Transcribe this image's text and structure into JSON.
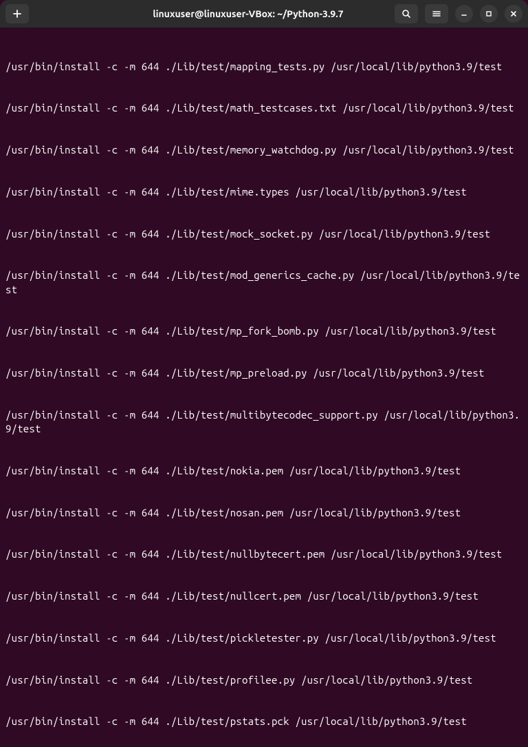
{
  "titlebar": {
    "title": "linuxuser@linuxuser-VBox: ~/Python-3.9.7"
  },
  "terminal": {
    "lines": [
      "/usr/bin/install -c -m 644 ./Lib/test/mapping_tests.py /usr/local/lib/python3.9/test",
      "/usr/bin/install -c -m 644 ./Lib/test/math_testcases.txt /usr/local/lib/python3.9/test",
      "/usr/bin/install -c -m 644 ./Lib/test/memory_watchdog.py /usr/local/lib/python3.9/test",
      "/usr/bin/install -c -m 644 ./Lib/test/mime.types /usr/local/lib/python3.9/test",
      "/usr/bin/install -c -m 644 ./Lib/test/mock_socket.py /usr/local/lib/python3.9/test",
      "/usr/bin/install -c -m 644 ./Lib/test/mod_generics_cache.py /usr/local/lib/python3.9/test",
      "/usr/bin/install -c -m 644 ./Lib/test/mp_fork_bomb.py /usr/local/lib/python3.9/test",
      "/usr/bin/install -c -m 644 ./Lib/test/mp_preload.py /usr/local/lib/python3.9/test",
      "/usr/bin/install -c -m 644 ./Lib/test/multibytecodec_support.py /usr/local/lib/python3.9/test",
      "/usr/bin/install -c -m 644 ./Lib/test/nokia.pem /usr/local/lib/python3.9/test",
      "/usr/bin/install -c -m 644 ./Lib/test/nosan.pem /usr/local/lib/python3.9/test",
      "/usr/bin/install -c -m 644 ./Lib/test/nullbytecert.pem /usr/local/lib/python3.9/test",
      "/usr/bin/install -c -m 644 ./Lib/test/nullcert.pem /usr/local/lib/python3.9/test",
      "/usr/bin/install -c -m 644 ./Lib/test/pickletester.py /usr/local/lib/python3.9/test",
      "/usr/bin/install -c -m 644 ./Lib/test/profilee.py /usr/local/lib/python3.9/test",
      "/usr/bin/install -c -m 644 ./Lib/test/pstats.pck /usr/local/lib/python3.9/test"
    ]
  }
}
